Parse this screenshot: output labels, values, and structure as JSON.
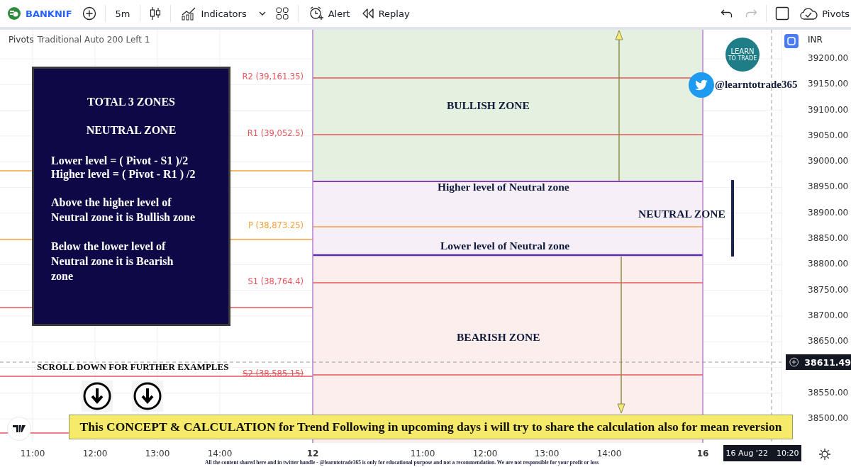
{
  "toolbar": {
    "symbol": "BANKNIF",
    "interval": "5m",
    "buttons": [
      {
        "kind": "indicators",
        "label": "Indicators"
      },
      {
        "kind": "alert",
        "label": "Alert"
      },
      {
        "kind": "replay",
        "label": "Replay"
      }
    ],
    "undo": {
      "disabled": false
    },
    "redo": {
      "disabled": true
    },
    "layout": "Pivots"
  },
  "chart": {
    "legend": {
      "name": "Pivots",
      "params": "Traditional Auto 200 Left 1"
    },
    "pivot_levels": [
      {
        "label": "R2 (39,161.35)",
        "kind": "resistance"
      },
      {
        "label": "R1 (39,052.5)",
        "kind": "resistance"
      },
      {
        "label": "P (38,873.25)",
        "kind": "pivot"
      },
      {
        "label": "S1 (38,764.4)",
        "kind": "support"
      },
      {
        "label": "S2 (38,585.15)",
        "kind": "support"
      }
    ],
    "info_box": {
      "title": "TOTAL 3 ZONES",
      "subtitle": "NEUTRAL ZONE",
      "formulas": [
        "Lower level = ( Pivot - S1 )/2",
        "Higher level = ( Pivot - R1 ) /2"
      ],
      "notes": [
        "Above the higher level of Neutral zone it is Bullish zone",
        "Below the lower level of Neutral zone it is Bearish zone"
      ]
    },
    "zone_labels": [
      "BULLISH ZONE",
      "Higher level of Neutral zone",
      "NEUTRAL ZONE",
      "Lower level of Neutral zone",
      "BEARISH ZONE"
    ],
    "logo": {
      "line_1": "LEARN",
      "line_2": "TO TRADE"
    },
    "handle": "@learntotrade365",
    "scroll_hint": "SCROLL DOWN FOR FURTHER EXAMPLES",
    "banner": "This CONCEPT & CALCULATION for Trend Following in upcoming days i will try to share the calculation also for mean reversion"
  },
  "price_axis": {
    "currency": "INR",
    "ticks": [
      "39200.00",
      "39150.00",
      "39100.00",
      "39050.00",
      "39000.00",
      "38950.00",
      "38900.00",
      "38850.00",
      "38800.00",
      "38750.00",
      "38700.00",
      "38650.00",
      "38550.00",
      "38500.00"
    ],
    "crosshair_price": "38611.49"
  },
  "time_axis": {
    "labels": [
      {
        "text": "11:00",
        "kind": "time"
      },
      {
        "text": "12:00",
        "kind": "time"
      },
      {
        "text": "13:00",
        "kind": "time"
      },
      {
        "text": "14:00",
        "kind": "time"
      },
      {
        "text": "12",
        "kind": "day"
      },
      {
        "text": "11:00",
        "kind": "time"
      },
      {
        "text": "12:00",
        "kind": "time"
      },
      {
        "text": "13:00",
        "kind": "time"
      },
      {
        "text": "14:00",
        "kind": "time"
      },
      {
        "text": "16",
        "kind": "day"
      }
    ],
    "crosshair_date": "16 Aug '22",
    "crosshair_time": "10:20"
  },
  "disclaimer": "All the content shared here and in twitter handle - @learntotrade365 is only for educational purpose and not a recommendation. We are not responsible for your profit or loss"
}
